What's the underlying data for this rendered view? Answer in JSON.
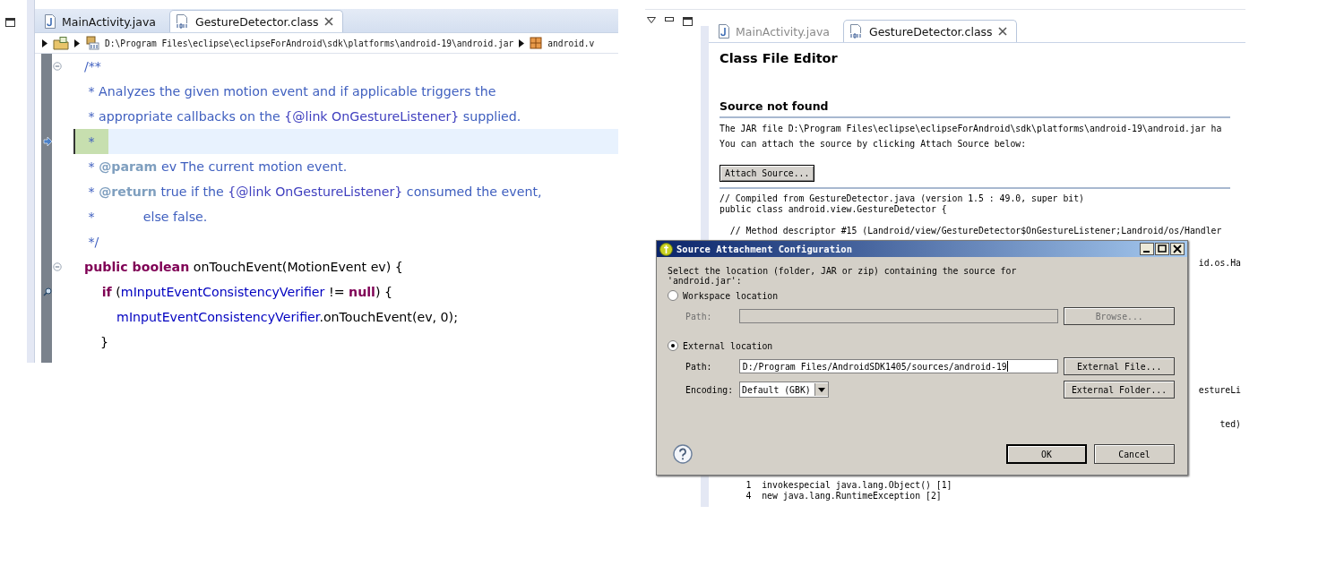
{
  "left_editor": {
    "focused": true,
    "tabs": [
      {
        "label": "MainActivity.java",
        "selected": false
      },
      {
        "label": "GestureDetector.class",
        "selected": true
      }
    ],
    "breadcrumb": [
      {
        "kind": "folder"
      },
      {
        "kind": "jar",
        "text": "D:\\Program Files\\eclipse\\eclipseForAndroid\\sdk\\platforms\\android-19\\android.jar"
      },
      {
        "kind": "package",
        "text": "android.v"
      }
    ],
    "code_lines": [
      {
        "fold": true,
        "current": false,
        "segments": [
          {
            "kind": "comment",
            "text": "/**"
          }
        ]
      },
      {
        "fold": false,
        "current": false,
        "segments": [
          {
            "kind": "comment",
            "text": " * Analyzes the given motion event and if applicable triggers the"
          }
        ]
      },
      {
        "fold": false,
        "current": false,
        "segments": [
          {
            "kind": "comment",
            "text": " * appropriate callbacks on the "
          },
          {
            "kind": "link",
            "text": "{@link OnGestureListener}"
          },
          {
            "kind": "comment",
            "text": " supplied."
          }
        ]
      },
      {
        "fold": false,
        "current": true,
        "annotation": true,
        "segments": [
          {
            "kind": "comment",
            "text": " *"
          }
        ]
      },
      {
        "fold": false,
        "current": false,
        "segments": [
          {
            "kind": "comment",
            "text": " * "
          },
          {
            "kind": "tag",
            "text": "@param"
          },
          {
            "kind": "comment",
            "text": " ev The current motion event."
          }
        ]
      },
      {
        "fold": false,
        "current": false,
        "segments": [
          {
            "kind": "comment",
            "text": " * "
          },
          {
            "kind": "tag",
            "text": "@return"
          },
          {
            "kind": "comment",
            "text": " true if the "
          },
          {
            "kind": "link",
            "text": "{@link OnGestureListener}"
          },
          {
            "kind": "comment",
            "text": " consumed the event,"
          }
        ]
      },
      {
        "fold": false,
        "current": false,
        "segments": [
          {
            "kind": "comment",
            "text": " *            else false."
          }
        ]
      },
      {
        "fold": false,
        "current": false,
        "segments": [
          {
            "kind": "comment",
            "text": " */"
          }
        ]
      },
      {
        "fold": true,
        "current": false,
        "segments": [
          {
            "kind": "keyword",
            "text": "public boolean"
          },
          {
            "kind": "plain",
            "text": " onTouchEvent(MotionEvent ev) {"
          }
        ]
      },
      {
        "fold": false,
        "current": false,
        "annotation": true,
        "segments": [
          {
            "kind": "keyword",
            "text": "    if"
          },
          {
            "kind": "plain",
            "text": " ("
          },
          {
            "kind": "field",
            "text": "mInputEventConsistencyVerifier"
          },
          {
            "kind": "plain",
            "text": " != "
          },
          {
            "kind": "keyword",
            "text": "null"
          },
          {
            "kind": "plain",
            "text": ") {"
          }
        ]
      },
      {
        "fold": false,
        "current": false,
        "segments": [
          {
            "kind": "field",
            "text": "        mInputEventConsistencyVerifier"
          },
          {
            "kind": "plain",
            "text": ".onTouchEvent(ev, 0);"
          }
        ]
      },
      {
        "fold": false,
        "current": false,
        "segments": [
          {
            "kind": "plain",
            "text": "    }"
          }
        ]
      }
    ]
  },
  "right_editor": {
    "focused": false,
    "tabs": [
      {
        "label": "MainActivity.java",
        "selected": false
      },
      {
        "label": "GestureDetector.class",
        "selected": true
      }
    ],
    "title": "Class File Editor",
    "heading": "Source not found",
    "message_lines": [
      "The JAR file D:\\Program Files\\eclipse\\eclipseForAndroid\\sdk\\platforms\\android-19\\android.jar ha",
      "You can attach the source by clicking Attach Source below:"
    ],
    "attach_button": "Attach Source...",
    "code_lines": [
      {
        "kind": "line",
        "text": "// Compiled from GestureDetector.java (version 1.5 : 49.0, super bit)"
      },
      {
        "kind": "line",
        "text": "public class android.view.GestureDetector {"
      },
      {
        "kind": "line",
        "text": "  // Method descriptor #15 (Landroid/view/GestureDetector$OnGestureListener;Landroid/os/Handler"
      },
      {
        "kind": "tail",
        "text": "id.os.Ha"
      },
      {
        "kind": "tail",
        "text": "estureLi"
      },
      {
        "kind": "tail",
        "text": "ted)"
      },
      {
        "kind": "line",
        "text": "     1  invokespecial java.lang.Object() [1]"
      },
      {
        "kind": "line",
        "text": "     4  new java.lang.RuntimeException [2]"
      }
    ]
  },
  "dialog": {
    "title": "Source Attachment Configuration",
    "message": "Select the location (folder, JAR or zip) containing the source for 'android.jar':",
    "options": [
      {
        "label": "Workspace location",
        "selected": false,
        "path_label": "Path:",
        "button": "Browse..."
      },
      {
        "label": "External location",
        "selected": true,
        "path_label": "Path:",
        "path_value": "D:/Program Files/AndroidSDK1405/sources/android-19",
        "button": "External File..."
      }
    ],
    "encoding": {
      "label": "Encoding:",
      "value": "Default (GBK)",
      "button": "External Folder..."
    },
    "buttons": [
      {
        "label": "OK",
        "default": true
      },
      {
        "label": "Cancel",
        "default": false
      }
    ]
  }
}
